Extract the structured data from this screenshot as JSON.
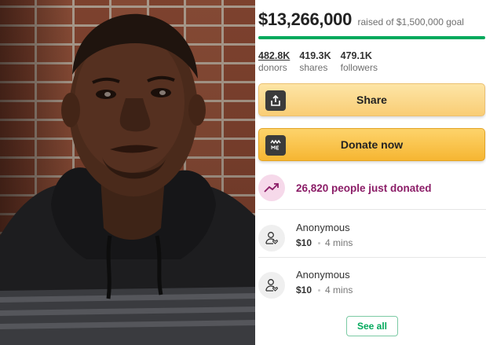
{
  "campaign": {
    "amount_raised": "$13,266,000",
    "goal_text": "raised of $1,500,000 goal",
    "progress_fraction": 1.0,
    "accent_color": "#02a95c"
  },
  "stats": [
    {
      "value": "482.8K",
      "label": "donors"
    },
    {
      "value": "419.3K",
      "label": "shares"
    },
    {
      "value": "479.1K",
      "label": "followers"
    }
  ],
  "buttons": {
    "share_label": "Share",
    "share_icon": "share-upload-icon",
    "donate_label": "Donate now",
    "donate_icon": "gofundme-logo-icon"
  },
  "recent_activity": {
    "icon": "trending-up-icon",
    "text": "26,820 people just donated"
  },
  "donations": [
    {
      "name": "Anonymous",
      "amount": "$10",
      "time": "4 mins"
    },
    {
      "name": "Anonymous",
      "amount": "$10",
      "time": "4 mins"
    }
  ],
  "see_all_label": "See all"
}
